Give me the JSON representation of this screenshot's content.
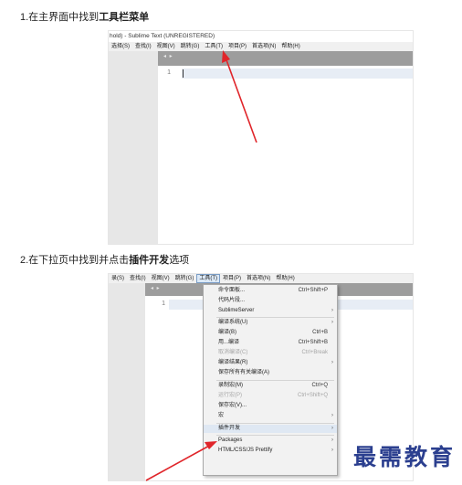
{
  "steps": [
    {
      "prefix": "1.在主界面中找到",
      "bold": "工具栏菜单"
    },
    {
      "prefix": "2.在下拉页中找到并点击",
      "bold": "插件开发",
      "suffix": "选项"
    }
  ],
  "shot1": {
    "window_title": "hold) - Sublime Text (UNREGISTERED)",
    "menus": [
      "选择(S)",
      "查找(I)",
      "视图(V)",
      "跳转(G)",
      "工具(T)",
      "项目(P)",
      "首选项(N)",
      "帮助(H)"
    ],
    "tab_arrows": "◂ ▸",
    "line_number": "1"
  },
  "shot2": {
    "menus": [
      "录(S)",
      "查找(I)",
      "视图(V)",
      "跳转(G)",
      "工具(T)",
      "项目(P)",
      "首选项(N)",
      "帮助(H)"
    ],
    "tab_arrows": "◂ ▸",
    "line_number": "1",
    "dropdown": [
      {
        "label": "命令面板...",
        "shortcut": "Ctrl+Shift+P",
        "arrow": ""
      },
      {
        "label": "代码片段...",
        "shortcut": "",
        "arrow": ""
      },
      {
        "label": "SublimeServer",
        "shortcut": "",
        "arrow": "›"
      },
      {
        "label": "编译系统(U)",
        "shortcut": "",
        "arrow": "›"
      },
      {
        "label": "编译(B)",
        "shortcut": "Ctrl+B",
        "arrow": ""
      },
      {
        "label": "用...编译",
        "shortcut": "Ctrl+Shift+B",
        "arrow": ""
      },
      {
        "label": "取消编译(C)",
        "shortcut": "Ctrl+Break",
        "arrow": ""
      },
      {
        "label": "编译结果(R)",
        "shortcut": "",
        "arrow": "›"
      },
      {
        "label": "保存所有有关编译(A)",
        "shortcut": "",
        "arrow": ""
      },
      {
        "label": "录制宏(M)",
        "shortcut": "Ctrl+Q",
        "arrow": ""
      },
      {
        "label": "运行宏(P)",
        "shortcut": "Ctrl+Shift+Q",
        "arrow": ""
      },
      {
        "label": "保存宏(V)...",
        "shortcut": "",
        "arrow": ""
      },
      {
        "label": "宏",
        "shortcut": "",
        "arrow": "›"
      },
      {
        "label": "插件开发",
        "shortcut": "",
        "arrow": "›"
      },
      {
        "label": "Packages",
        "shortcut": "",
        "arrow": "›"
      },
      {
        "label": "HTML/CSS/JS Prettify",
        "shortcut": "",
        "arrow": "›"
      }
    ]
  },
  "watermark": "最需教育",
  "colors": {
    "arrow": "#e0252a",
    "watermark": "#2b3f8f",
    "menu_highlight": "#dbe8f6"
  }
}
